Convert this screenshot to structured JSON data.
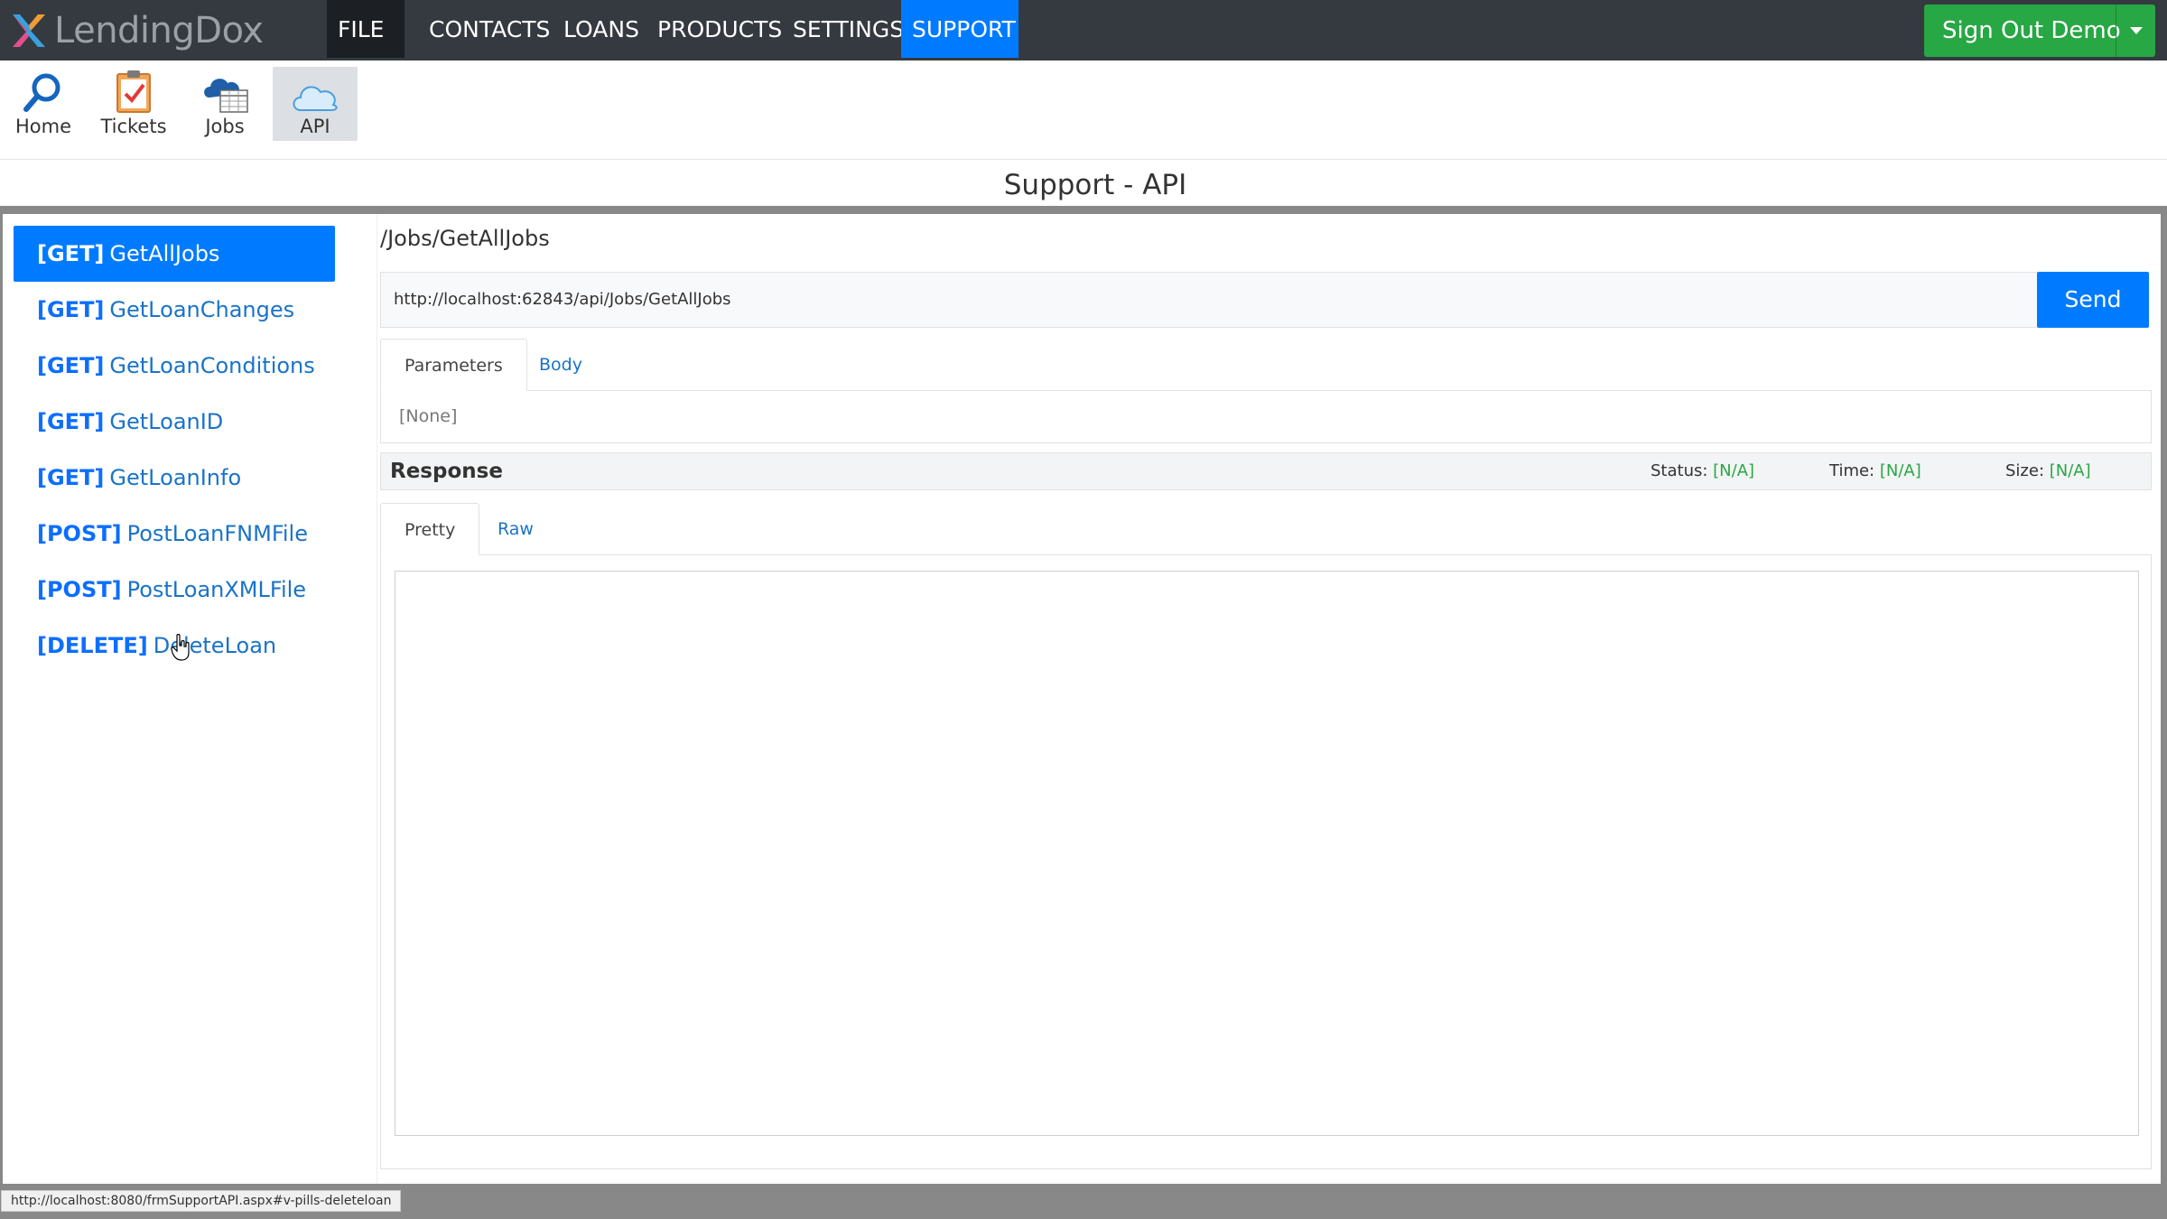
{
  "app": {
    "brand": "LendingDox"
  },
  "nav": {
    "file": "FILE",
    "contacts": "CONTACTS",
    "loans": "LOANS",
    "products": "PRODUCTS",
    "settings": "SETTINGS",
    "support": "SUPPORT",
    "signout": "Sign Out Demo"
  },
  "toolbar": {
    "home": "Home",
    "tickets": "Tickets",
    "jobs": "Jobs",
    "api": "API"
  },
  "page": {
    "title": "Support - API"
  },
  "endpoints": [
    {
      "method": "[GET]",
      "name": "GetAllJobs"
    },
    {
      "method": "[GET]",
      "name": "GetLoanChanges"
    },
    {
      "method": "[GET]",
      "name": "GetLoanConditions"
    },
    {
      "method": "[GET]",
      "name": "GetLoanID"
    },
    {
      "method": "[GET]",
      "name": "GetLoanInfo"
    },
    {
      "method": "[POST]",
      "name": "PostLoanFNMFile"
    },
    {
      "method": "[POST]",
      "name": "PostLoanXMLFile"
    },
    {
      "method": "[DELETE]",
      "name": "DeleteLoan"
    }
  ],
  "request": {
    "path": "/Jobs/GetAllJobs",
    "url": "http://localhost:62843/api/Jobs/GetAllJobs",
    "send": "Send",
    "tabs": [
      "Parameters",
      "Body"
    ],
    "params_value": "[None]"
  },
  "response": {
    "title": "Response",
    "status_label": "Status:",
    "status_value": "[N/A]",
    "time_label": "Time:",
    "time_value": "[N/A]",
    "size_label": "Size:",
    "size_value": "[N/A]",
    "tabs": [
      "Pretty",
      "Raw"
    ]
  },
  "statusbar": {
    "url": "http://localhost:8080/frmSupportAPI.aspx#v-pills-deleteloan"
  },
  "colors": {
    "primary": "#007bff",
    "navbar": "#343a40",
    "success": "#28a745"
  }
}
